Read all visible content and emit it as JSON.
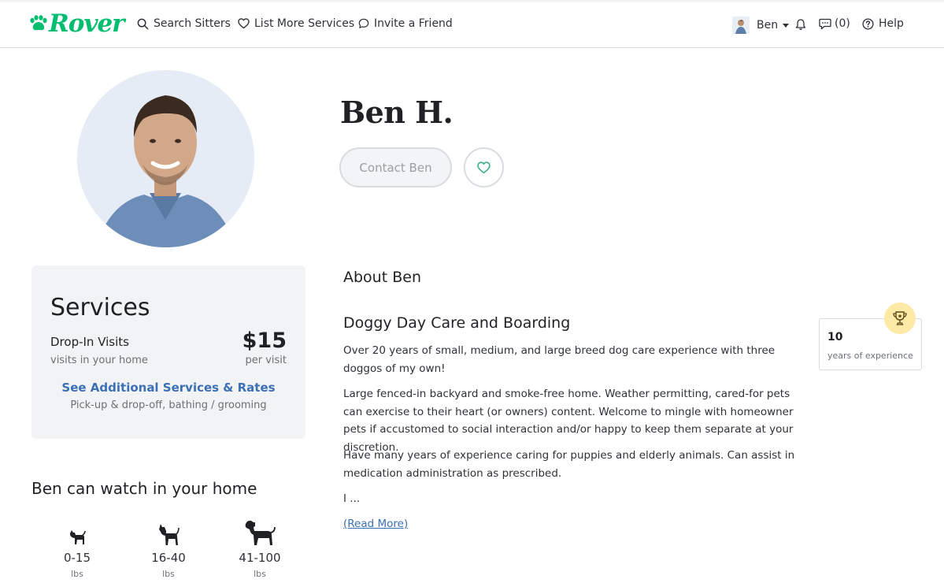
{
  "brand": {
    "name": "Rover",
    "color": "#00bd70"
  },
  "nav": {
    "search_label": "Search Sitters",
    "list_label": "List More Services",
    "invite_label": "Invite a Friend",
    "user_name": "Ben",
    "messages_label": "(0)",
    "help_label": "Help"
  },
  "profile": {
    "name": "Ben H.",
    "contact_label": "Contact Ben"
  },
  "services": {
    "title": "Services",
    "primary": {
      "name": "Drop-In Visits",
      "subtitle": "visits in your home",
      "price": "$15",
      "unit": "per visit"
    },
    "more_label": "See Additional Services & Rates",
    "more_subtitle": "Pick-up & drop-off, bathing / grooming"
  },
  "watch": {
    "title": "Ben can watch in your home",
    "sizes": [
      {
        "range": "0-15",
        "unit": "lbs",
        "icon": "small-dog-icon"
      },
      {
        "range": "16-40",
        "unit": "lbs",
        "icon": "medium-dog-icon"
      },
      {
        "range": "41-100",
        "unit": "lbs",
        "icon": "large-dog-icon"
      }
    ]
  },
  "about": {
    "title": "About Ben",
    "headline": "Doggy Day Care and Boarding",
    "paragraphs": [
      "Over 20 years of small, medium, and large breed dog care experience with three doggos of my own!",
      "Large fenced-in backyard and smoke-free home. Weather permitting, cared-for pets can exercise to their heart (or owners) content. Welcome to mingle with homeowner pets if accustomed to social interaction and/or happy to keep them separate at your discretion.",
      "Have many years of experience caring for puppies and elderly animals. Can assist in medication administration as prescribed.",
      "I ..."
    ],
    "read_more_label": "(Read More)"
  },
  "experience": {
    "years": "10",
    "label": "years of experience",
    "icon": "trophy-icon"
  }
}
